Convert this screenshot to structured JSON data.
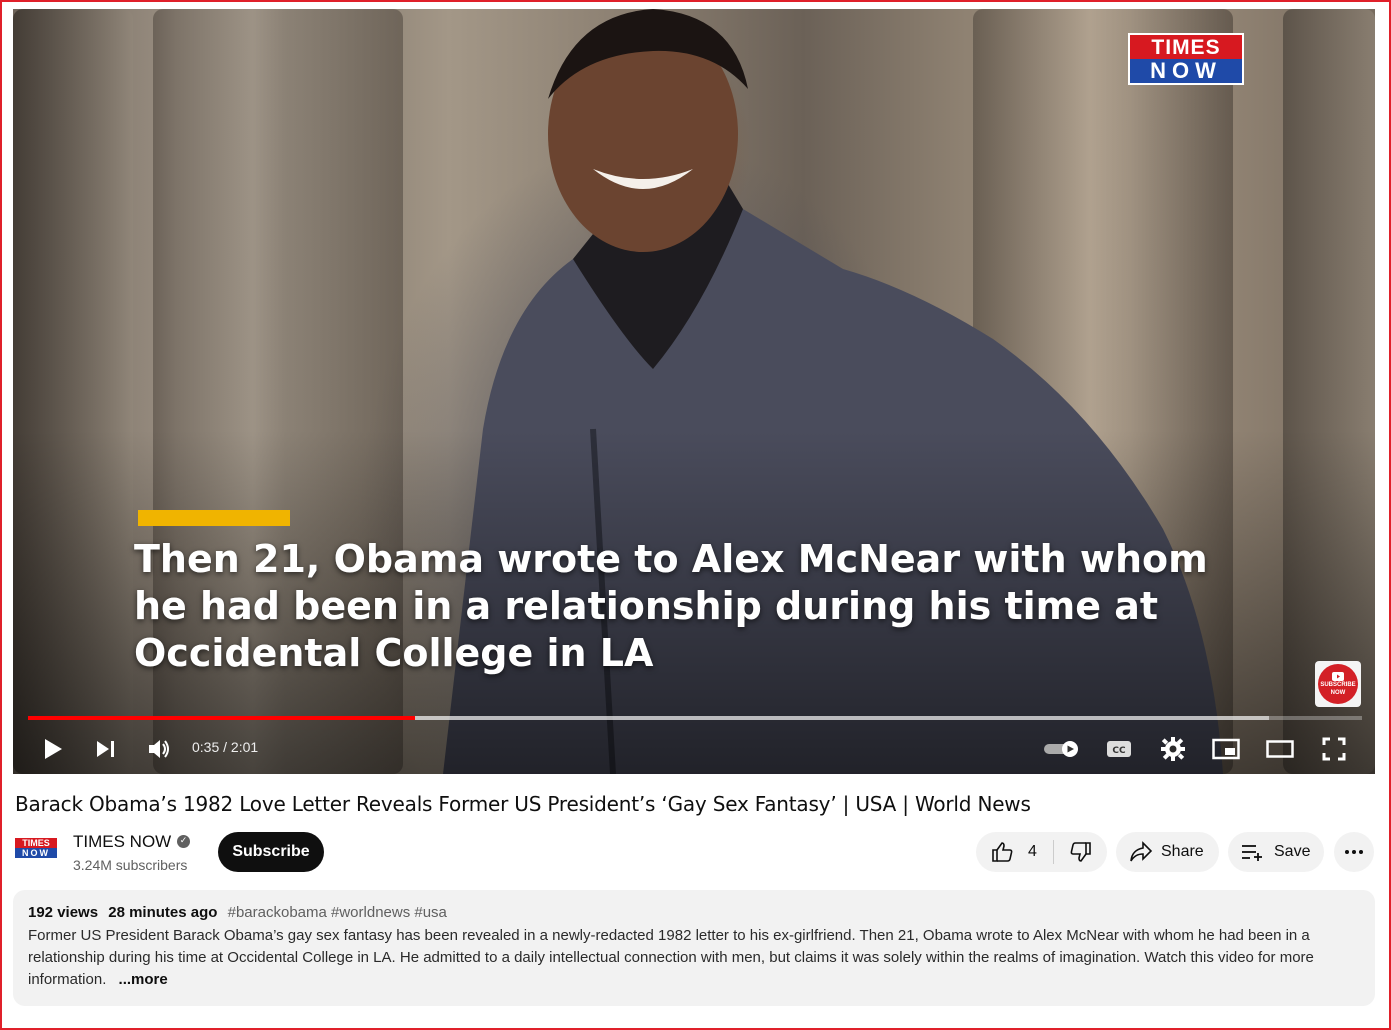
{
  "video": {
    "logo": {
      "line1": "TIMES",
      "line2": "NOW"
    },
    "caption": "Then 21, Obama wrote to Alex McNear with whom he had been in a relationship during his time at Occidental College in LA",
    "subscribe_badge": {
      "line1": "SUBSCRIBE",
      "line2": "NOW"
    },
    "progress": {
      "played_fraction": 0.29,
      "buffered_fraction": 0.93
    },
    "time_display": "0:35 / 2:01",
    "icons": [
      "play-icon",
      "next-icon",
      "volume-icon",
      "autoplay-toggle-icon",
      "cc-icon",
      "settings-gear-icon",
      "miniplayer-icon",
      "theater-mode-icon",
      "fullscreen-icon"
    ]
  },
  "title": "Barack Obama’s 1982 Love Letter Reveals Former US President’s ‘Gay Sex Fantasy’ | USA | World News",
  "channel": {
    "avatar": {
      "line1": "TIMES",
      "line2": "NOW"
    },
    "name": "TIMES NOW",
    "verified_mark": "✓",
    "subscribers": "3.24M subscribers",
    "subscribe_label": "Subscribe"
  },
  "actions": {
    "like_count": "4",
    "share_label": "Share",
    "save_label": "Save"
  },
  "description": {
    "views": "192 views",
    "age": "28 minutes ago",
    "tags": "#barackobama #worldnews #usa",
    "text": "Former US President Barack Obama’s gay sex fantasy has been revealed in a newly-redacted 1982 letter to his ex-girlfriend. Then 21, Obama wrote to Alex McNear with whom he had been in a relationship during his time at Occidental College in LA. He admitted to a daily intellectual connection with men, but claims it was solely within the realms of imagination. Watch this video for more information.",
    "more_label": "...more"
  },
  "colors": {
    "accent_red": "#ff0000",
    "caption_bar": "#f0b400",
    "subscribe_bg": "#0f0f0f"
  }
}
